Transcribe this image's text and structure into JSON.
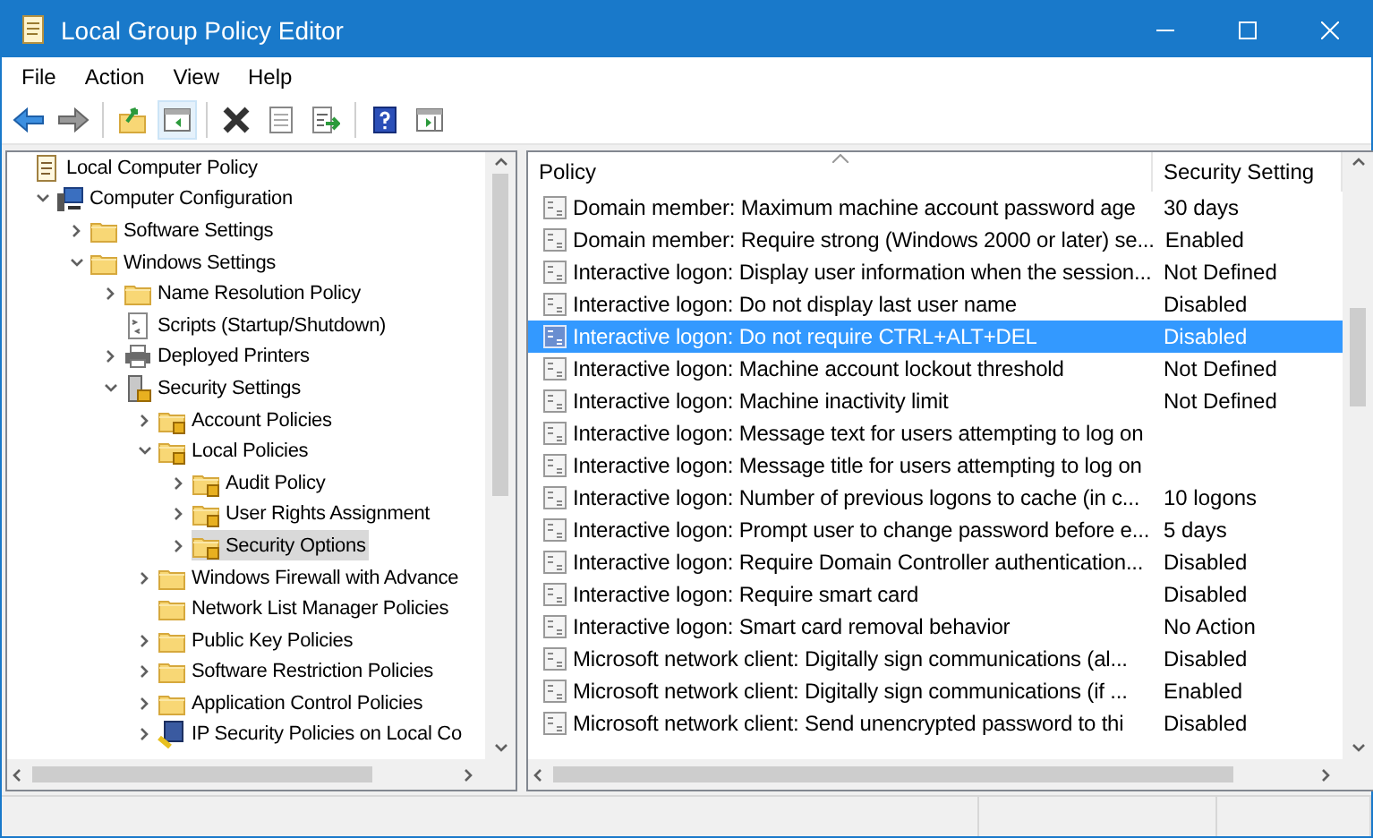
{
  "window": {
    "title": "Local Group Policy Editor"
  },
  "menu": [
    "File",
    "Action",
    "View",
    "Help"
  ],
  "toolbar": [
    {
      "kind": "back"
    },
    {
      "kind": "forward"
    },
    {
      "kind": "sep"
    },
    {
      "kind": "up"
    },
    {
      "kind": "tree"
    },
    {
      "kind": "sep"
    },
    {
      "kind": "delete"
    },
    {
      "kind": "properties"
    },
    {
      "kind": "export"
    },
    {
      "kind": "sep"
    },
    {
      "kind": "help"
    },
    {
      "kind": "pane"
    }
  ],
  "tree": [
    {
      "label": "Local Computer Policy",
      "kind": "policy",
      "selected": false,
      "children": [
        {
          "label": "Computer Configuration",
          "kind": "computer",
          "expanded": true,
          "selected": false,
          "children": [
            {
              "label": "Software Settings",
              "kind": "folder",
              "expanded": false,
              "selected": false
            },
            {
              "label": "Windows Settings",
              "kind": "folder",
              "expanded": true,
              "selected": false,
              "children": [
                {
                  "label": "Name Resolution Policy",
                  "kind": "folder",
                  "expanded": false,
                  "selected": false
                },
                {
                  "label": "Scripts (Startup/Shutdown)",
                  "kind": "script",
                  "selected": false
                },
                {
                  "label": "Deployed Printers",
                  "kind": "printer",
                  "expanded": false,
                  "selected": false
                },
                {
                  "label": "Security Settings",
                  "kind": "server",
                  "expanded": true,
                  "selected": false,
                  "children": [
                    {
                      "label": "Account Policies",
                      "kind": "lockfolder",
                      "expanded": false,
                      "selected": false
                    },
                    {
                      "label": "Local Policies",
                      "kind": "lockfolder",
                      "expanded": true,
                      "selected": false,
                      "children": [
                        {
                          "label": "Audit Policy",
                          "kind": "lockfolder",
                          "expanded": false,
                          "selected": false
                        },
                        {
                          "label": "User Rights Assignment",
                          "kind": "lockfolder",
                          "expanded": false,
                          "selected": false
                        },
                        {
                          "label": "Security Options",
                          "kind": "lockfolder",
                          "expanded": false,
                          "selected": true
                        }
                      ]
                    },
                    {
                      "label": "Windows Firewall with Advance",
                      "kind": "folder",
                      "expanded": false,
                      "selected": false
                    },
                    {
                      "label": "Network List Manager Policies",
                      "kind": "folder",
                      "selected": false
                    },
                    {
                      "label": "Public Key Policies",
                      "kind": "folder",
                      "expanded": false,
                      "selected": false
                    },
                    {
                      "label": "Software Restriction Policies",
                      "kind": "folder",
                      "expanded": false,
                      "selected": false
                    },
                    {
                      "label": "Application Control Policies",
                      "kind": "folder",
                      "expanded": false,
                      "selected": false
                    },
                    {
                      "label": "IP Security Policies on Local Co",
                      "kind": "ip",
                      "expanded": false,
                      "selected": false
                    }
                  ]
                }
              ]
            }
          ]
        }
      ]
    }
  ],
  "table": {
    "columns": [
      "Policy",
      "Security Setting"
    ],
    "rows": [
      {
        "policy": "Domain member: Maximum machine account password age",
        "setting": "30 days",
        "selected": false
      },
      {
        "policy": "Domain member: Require strong (Windows 2000 or later) se...",
        "setting": "Enabled",
        "selected": false
      },
      {
        "policy": "Interactive logon: Display user information when the session...",
        "setting": "Not Defined",
        "selected": false
      },
      {
        "policy": "Interactive logon: Do not display last user name",
        "setting": "Disabled",
        "selected": false
      },
      {
        "policy": "Interactive logon: Do not require CTRL+ALT+DEL",
        "setting": "Disabled",
        "selected": true
      },
      {
        "policy": "Interactive logon: Machine account lockout threshold",
        "setting": "Not Defined",
        "selected": false
      },
      {
        "policy": "Interactive logon: Machine inactivity limit",
        "setting": "Not Defined",
        "selected": false
      },
      {
        "policy": "Interactive logon: Message text for users attempting to log on",
        "selected": false
      },
      {
        "policy": "Interactive logon: Message title for users attempting to log on",
        "selected": false
      },
      {
        "policy": "Interactive logon: Number of previous logons to cache (in c...",
        "setting": "10 logons",
        "selected": false
      },
      {
        "policy": "Interactive logon: Prompt user to change password before e...",
        "setting": "5 days",
        "selected": false
      },
      {
        "policy": "Interactive logon: Require Domain Controller authentication...",
        "setting": "Disabled",
        "selected": false
      },
      {
        "policy": "Interactive logon: Require smart card",
        "setting": "Disabled",
        "selected": false
      },
      {
        "policy": "Interactive logon: Smart card removal behavior",
        "setting": "No Action",
        "selected": false
      },
      {
        "policy": "Microsoft network client: Digitally sign communications (al...",
        "setting": "Disabled",
        "selected": false
      },
      {
        "policy": "Microsoft network client: Digitally sign communications (if ...",
        "setting": "Enabled",
        "selected": false
      },
      {
        "policy": "Microsoft network client: Send unencrypted password to thi",
        "setting": "Disabled",
        "selected": false
      }
    ]
  }
}
